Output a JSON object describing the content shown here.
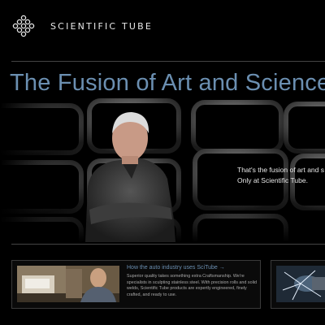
{
  "header": {
    "brand": "SCIENTIFIC TUBE"
  },
  "hero": {
    "headline": "The Fusion of Art and Science",
    "tagline_line1": "That's the fusion of art and s",
    "tagline_line2": "Only at Scientific Tube."
  },
  "features": [
    {
      "title": "How the auto industry uses SciTube →",
      "body": "Superior quality takes something extra Craftsmanship. We're specialists in sculpting stainless steel. With precision rolls and solid welds, Scientific Tube products are expertly engineered, finely crafted, and ready to use."
    }
  ],
  "colors": {
    "accent": "#6b8fb1",
    "background": "#000000",
    "rule": "#444444"
  },
  "icons": {
    "logo": "diamond-dot-grid-icon"
  }
}
